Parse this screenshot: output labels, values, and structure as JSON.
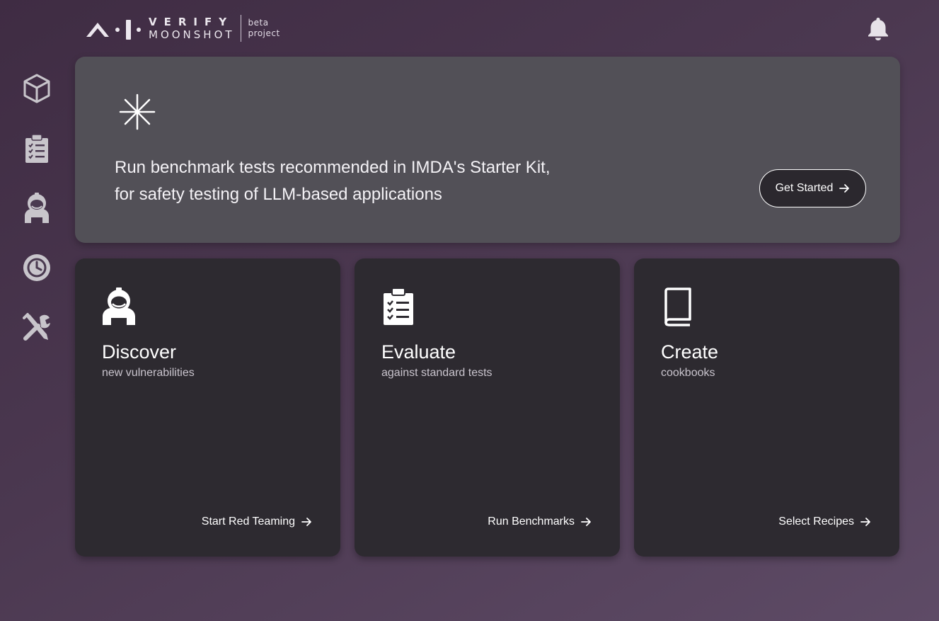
{
  "header": {
    "logo": {
      "wordmark_top": "VERIFY",
      "wordmark_bottom": "MOONSHOT",
      "tag_line1": "beta",
      "tag_line2": "project",
      "mark_icon": "ai-verify-logo-mark"
    },
    "notifications_icon": "bell-icon"
  },
  "sidebar": {
    "items": [
      {
        "icon": "cube-icon"
      },
      {
        "icon": "clipboard-checklist-icon"
      },
      {
        "icon": "astronaut-icon"
      },
      {
        "icon": "history-clock-icon"
      },
      {
        "icon": "tools-icon"
      }
    ]
  },
  "hero": {
    "icon": "asterisk-sparkle-icon",
    "line1": "Run benchmark tests recommended in IMDA's Starter Kit,",
    "line2": "for safety testing of LLM-based applications",
    "button_label": "Get Started"
  },
  "cards": [
    {
      "icon": "astronaut-icon",
      "title": "Discover",
      "subtitle": "new vulnerabilities",
      "action": "Start Red Teaming"
    },
    {
      "icon": "clipboard-checklist-icon",
      "title": "Evaluate",
      "subtitle": "against standard tests",
      "action": "Run Benchmarks"
    },
    {
      "icon": "book-icon",
      "title": "Create",
      "subtitle": "cookbooks",
      "action": "Select Recipes"
    }
  ],
  "colors": {
    "background_top": "#3f2c43",
    "background_bottom": "#5e4b66",
    "hero_panel": "#525057",
    "card_panel": "#2d2a30",
    "text_primary": "#ffffff",
    "text_secondary": "#c9c4cd",
    "icon_gray": "#c8c5cb"
  }
}
